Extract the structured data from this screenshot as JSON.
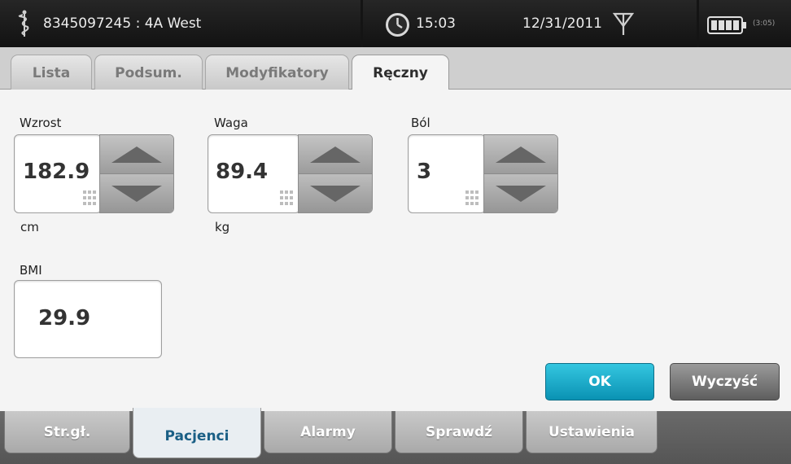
{
  "status_bar": {
    "patient": "8345097245 : 4A West",
    "time": "15:03",
    "date": "12/31/2011",
    "battery_time": "(3:05)",
    "icons": [
      "caduceus-icon",
      "clock-icon",
      "antenna-icon",
      "battery-icon"
    ]
  },
  "top_tabs": [
    {
      "label": "Lista",
      "active": false
    },
    {
      "label": "Podsum.",
      "active": false
    },
    {
      "label": "Modyfikatory",
      "active": false
    },
    {
      "label": "Ręczny",
      "active": true
    }
  ],
  "fields": {
    "height": {
      "label": "Wzrost",
      "value": "182.9",
      "unit": "cm"
    },
    "weight": {
      "label": "Waga",
      "value": "89.4",
      "unit": "kg"
    },
    "pain": {
      "label": "Ból",
      "value": "3"
    },
    "bmi": {
      "label": "BMI",
      "value": "29.9"
    }
  },
  "buttons": {
    "ok": "OK",
    "clear": "Wyczyść"
  },
  "bottom_nav": [
    {
      "label": "Str.gł.",
      "active": false
    },
    {
      "label": "Pacjenci",
      "active": true
    },
    {
      "label": "Alarmy",
      "active": false
    },
    {
      "label": "Sprawdź",
      "active": false
    },
    {
      "label": "Ustawienia",
      "active": false
    }
  ],
  "colors": {
    "ok_button": "#0a92b3",
    "active_nav_text": "#1a5f85",
    "status_bar": "#141414"
  }
}
